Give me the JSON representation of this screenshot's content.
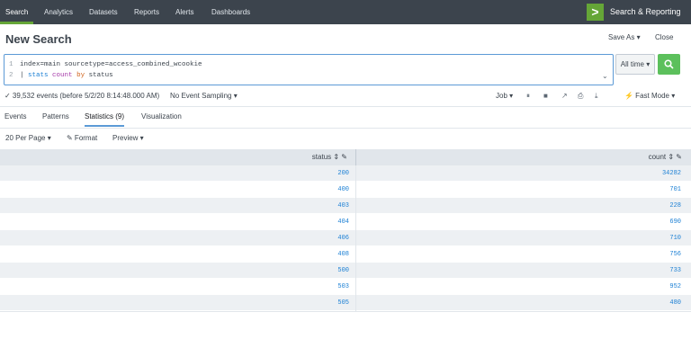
{
  "nav": {
    "items": [
      "Search",
      "Analytics",
      "Datasets",
      "Reports",
      "Alerts",
      "Dashboards"
    ],
    "app_title": "Search & Reporting",
    "logo_glyph": ">"
  },
  "header": {
    "title": "New Search",
    "save_as": "Save As ▾",
    "close": "Close"
  },
  "search": {
    "line_numbers": [
      "1",
      "2"
    ],
    "line1": "index=main sourcetype=access_combined_wcookie",
    "line2_pipe": "| ",
    "line2_cmd": "stats",
    "line2_fn": "count",
    "line2_by": "by",
    "line2_field": "status",
    "chevron": "⌄",
    "time_range": "All time ▾"
  },
  "status": {
    "events": "✓ 39,532 events (before 5/2/20 8:14:48.000 AM)",
    "sampling": "No Event Sampling ▾",
    "job": "Job ▾",
    "mode": "⚡ Fast Mode ▾"
  },
  "tabs": [
    "Events",
    "Patterns",
    "Statistics (9)",
    "Visualization"
  ],
  "options": {
    "per_page": "20 Per Page ▾",
    "format": "✎ Format",
    "preview": "Preview ▾"
  },
  "table": {
    "columns": [
      "status ⇕ ✎",
      "count ⇕ ✎"
    ],
    "rows": [
      {
        "status": "200",
        "count": "34282"
      },
      {
        "status": "400",
        "count": "701"
      },
      {
        "status": "403",
        "count": "228"
      },
      {
        "status": "404",
        "count": "690"
      },
      {
        "status": "406",
        "count": "710"
      },
      {
        "status": "408",
        "count": "756"
      },
      {
        "status": "500",
        "count": "733"
      },
      {
        "status": "503",
        "count": "952"
      },
      {
        "status": "505",
        "count": "480"
      }
    ]
  },
  "colors": {
    "appbar": "#3c444d",
    "accent_green": "#65a637",
    "search_button": "#5cc05c",
    "link_blue": "#1a7fd4",
    "tab_active": "#5c9ad6"
  }
}
